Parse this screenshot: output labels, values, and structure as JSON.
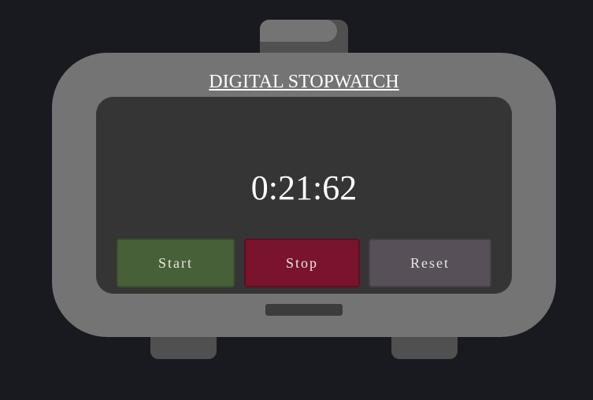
{
  "app": {
    "title": "DIGITAL STOPWATCH"
  },
  "display": {
    "time": "0:21:62"
  },
  "controls": {
    "start_label": "Start",
    "stop_label": "Stop",
    "reset_label": "Reset"
  },
  "colors": {
    "background": "#181a20",
    "casing": "#747474",
    "screen": "#343534",
    "start": "#486038",
    "stop": "#79142c",
    "reset": "#585059"
  }
}
